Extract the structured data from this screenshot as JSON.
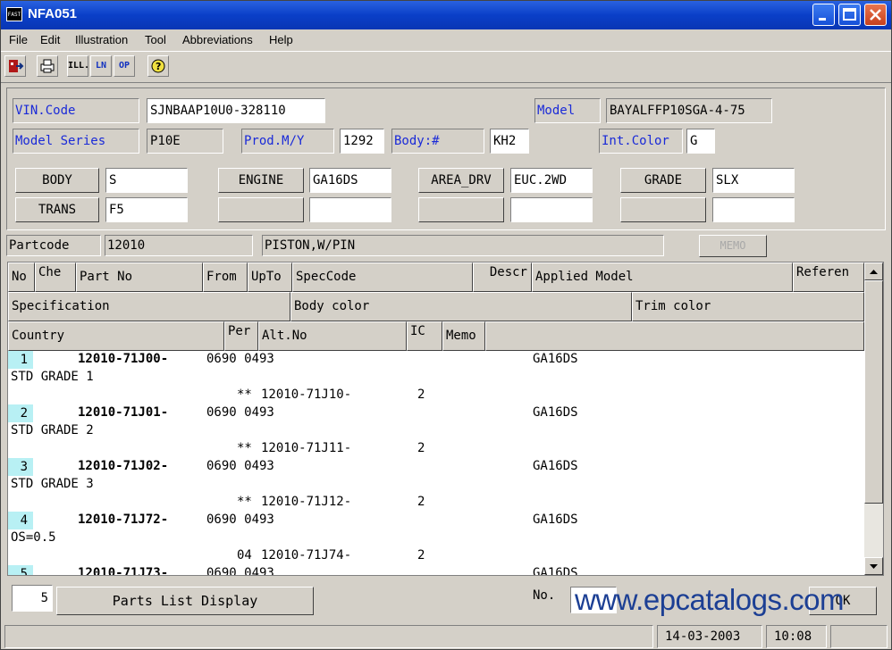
{
  "window": {
    "title": "NFA051",
    "icon_text": "FAST"
  },
  "menu": [
    "File",
    "Edit",
    "Illustration",
    "Tool",
    "Abbreviations",
    "Help"
  ],
  "toolbar": {
    "ill_label": "ILL.",
    "ln_label": "LN",
    "op_label": "OP"
  },
  "vehicle": {
    "vin_label": "VIN.Code",
    "vin": "SJNBAAP10U0-328110",
    "model_label": "Model",
    "model": "BAYALFFP10SGA-4-75",
    "series_label": "Model Series",
    "series": "P10E",
    "prod_label": "Prod.M/Y",
    "prod": "1292",
    "body_no_label": "Body:#",
    "body_no": "KH2",
    "int_color_label": "Int.Color",
    "int_color": "G",
    "body_label": "BODY",
    "body": "S",
    "engine_label": "ENGINE",
    "engine": "GA16DS",
    "area_label": "AREA_DRV",
    "area": "EUC.2WD",
    "grade_label": "GRADE",
    "grade": "SLX",
    "trans_label": "TRANS",
    "trans": "F5"
  },
  "partcode": {
    "label": "Partcode",
    "code": "12010",
    "name": "PISTON,W/PIN",
    "memo_label": "MEMO"
  },
  "headers": {
    "row1": [
      "No",
      "Che",
      "Part No",
      "From",
      "UpTo",
      "SpecCode",
      "Descr",
      "Applied Model",
      "Referen"
    ],
    "row2": [
      "Specification",
      "Body color",
      "Trim color"
    ],
    "row3": [
      "Country",
      "Per",
      "Alt.No",
      "IC",
      "Memo"
    ]
  },
  "rows": [
    {
      "no": "1",
      "part": "12010-71J00-",
      "from_upto": "0690 0493",
      "model": "GA16DS",
      "spec": "STD GRADE 1",
      "alt_prefix": "**",
      "alt": "12010-71J10-",
      "ic": "2"
    },
    {
      "no": "2",
      "part": "12010-71J01-",
      "from_upto": "0690 0493",
      "model": "GA16DS",
      "spec": "STD GRADE 2",
      "alt_prefix": "**",
      "alt": "12010-71J11-",
      "ic": "2"
    },
    {
      "no": "3",
      "part": "12010-71J02-",
      "from_upto": "0690 0493",
      "model": "GA16DS",
      "spec": "STD GRADE 3",
      "alt_prefix": "**",
      "alt": "12010-71J12-",
      "ic": "2"
    },
    {
      "no": "4",
      "part": "12010-71J72-",
      "from_upto": "0690 0493",
      "model": "GA16DS",
      "spec": "OS=0.5",
      "alt_prefix": "04",
      "alt": "12010-71J74-",
      "ic": "2"
    },
    {
      "no": "5",
      "part": "12010-71J73-",
      "from_upto": "0690 0493",
      "model": "GA16DS",
      "spec": "",
      "alt_prefix": "",
      "alt": "",
      "ic": ""
    }
  ],
  "footer": {
    "count": "5",
    "display_button": "Parts List Display",
    "no_label": "No.",
    "ok_label": "OK"
  },
  "status": {
    "date": "14-03-2003",
    "time": "10:08"
  },
  "watermark": "www.epcatalogs.com"
}
